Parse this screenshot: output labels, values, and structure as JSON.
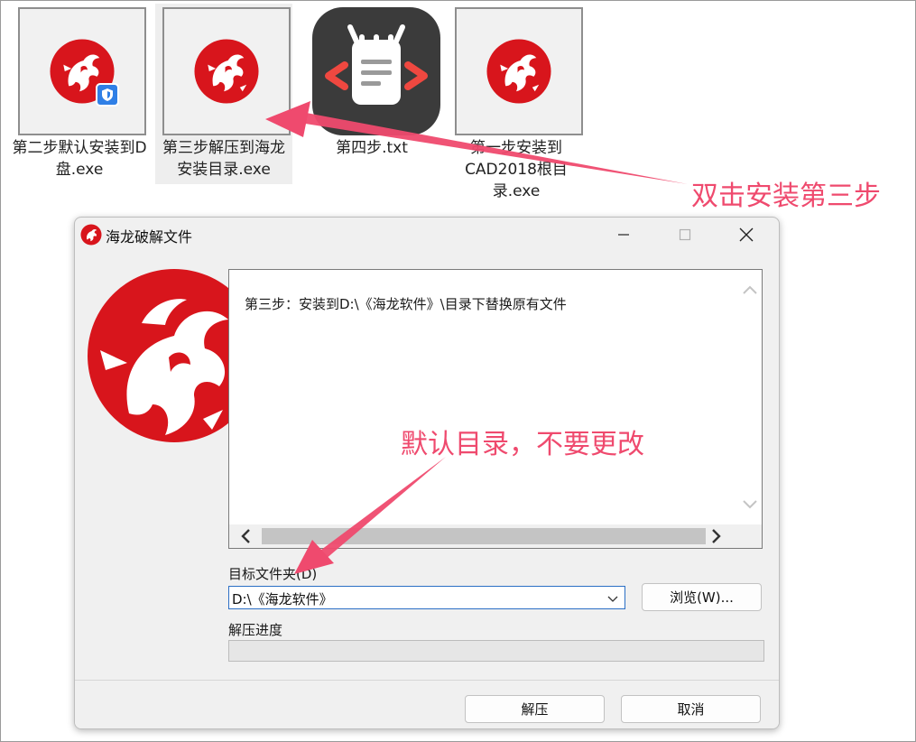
{
  "desktop": {
    "files": [
      {
        "label": "第二步默认安装到D盘.exe",
        "icon": "dragon-logo-icon"
      },
      {
        "label": "第三步解压到海龙安装目录.exe",
        "icon": "dragon-logo-icon"
      },
      {
        "label": "第四步.txt",
        "icon": "text-file-icon"
      },
      {
        "label": "第一步安装到CAD2018根目录.exe",
        "icon": "dragon-logo-icon"
      }
    ]
  },
  "annotations": {
    "step_hint": "双击安装第三步",
    "dir_hint": "默认目录，不要更改"
  },
  "dialog": {
    "title": "海龙破解文件",
    "info_text": "第三步：安装到D:\\《海龙软件》\\目录下替换原有文件",
    "target_label": "目标文件夹(D)",
    "target_value": "D:\\《海龙软件》",
    "browse_label": "浏览(W)...",
    "progress_label": "解压进度",
    "progress": 0,
    "extract_label": "解压",
    "cancel_label": "取消"
  },
  "colors": {
    "annotation": "#ef4a6e",
    "logo_red": "#d8151c",
    "accent": "#2b6fc5"
  }
}
